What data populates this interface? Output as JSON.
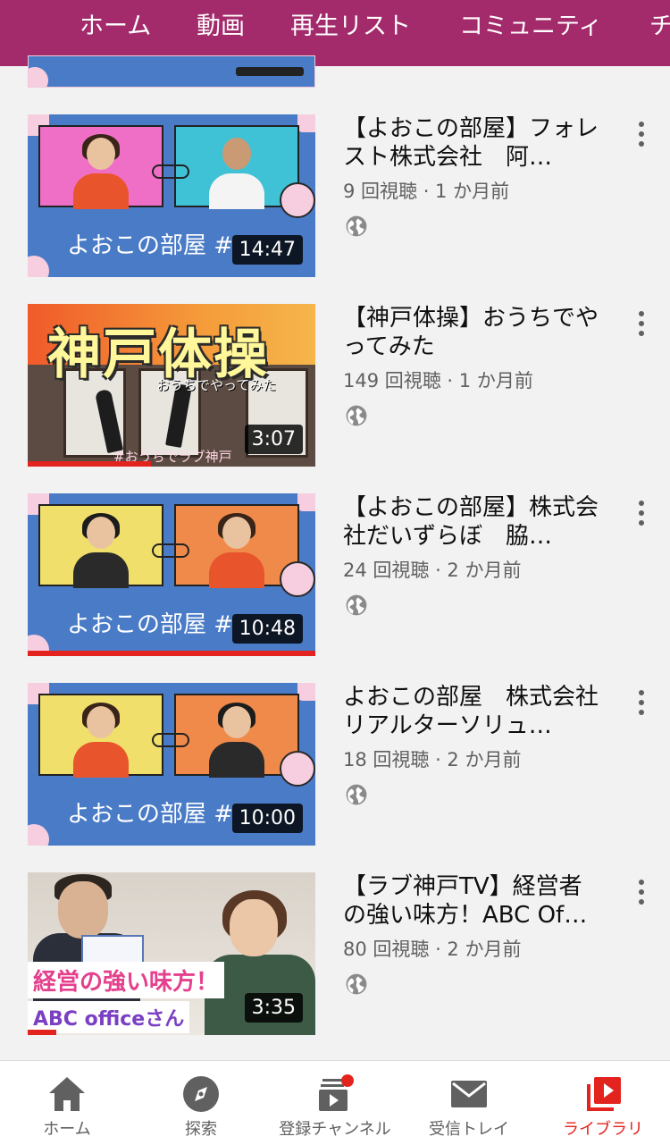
{
  "tabs": [
    {
      "label": "ホーム"
    },
    {
      "label": "動画"
    },
    {
      "label": "再生リスト"
    },
    {
      "label": "コミュニティ"
    },
    {
      "label": "チ"
    }
  ],
  "active_tab": "動画",
  "videos": [
    {
      "title": "【よおこの部屋】フォレスト株式会社　阿…",
      "meta": "9 回視聴 · 1 か月前",
      "duration": "14:47",
      "thumb_text": "よおこの部屋 #",
      "visibility_icon": "globe-icon"
    },
    {
      "title": "【神戸体操】おうちでやってみた",
      "meta": "149 回視聴 · 1 か月前",
      "duration": "3:07",
      "thumb_big": "神戸体操",
      "thumb_sub": "おうちでやってみた",
      "thumb_tag": "#おうちでラブ神戸",
      "watch_progress": 0.43,
      "visibility_icon": "globe-icon"
    },
    {
      "title": "【よおこの部屋】株式会社だいずらぼ　脇…",
      "meta": "24 回視聴 · 2 か月前",
      "duration": "10:48",
      "thumb_text": "よおこの部屋 #",
      "watch_progress": 1.0,
      "visibility_icon": "globe-icon"
    },
    {
      "title": "よおこの部屋　株式会社リアルターソリュ…",
      "meta": "18 回視聴 · 2 か月前",
      "duration": "10:00",
      "thumb_text": "よおこの部屋 #",
      "visibility_icon": "globe-icon"
    },
    {
      "title": "【ラブ神戸TV】経営者の強い味方！ABC Of…",
      "meta": "80 回視聴 · 2 か月前",
      "duration": "3:35",
      "thumb_caption1": "経営の強い味方！",
      "thumb_caption2": "ABC officeさん",
      "watch_progress": 0.1,
      "visibility_icon": "globe-icon"
    }
  ],
  "bottom_nav": [
    {
      "label": "ホーム",
      "icon": "home-icon"
    },
    {
      "label": "探索",
      "icon": "compass-icon"
    },
    {
      "label": "登録チャンネル",
      "icon": "subscriptions-icon"
    },
    {
      "label": "受信トレイ",
      "icon": "mail-icon"
    },
    {
      "label": "ライブラリ",
      "icon": "library-icon"
    }
  ],
  "colors": {
    "header_bg": "#a32a6b",
    "accent_red": "#e3231e",
    "thumb_blue": "#4a7bc7",
    "thumb_pink": "#f7cde0"
  }
}
